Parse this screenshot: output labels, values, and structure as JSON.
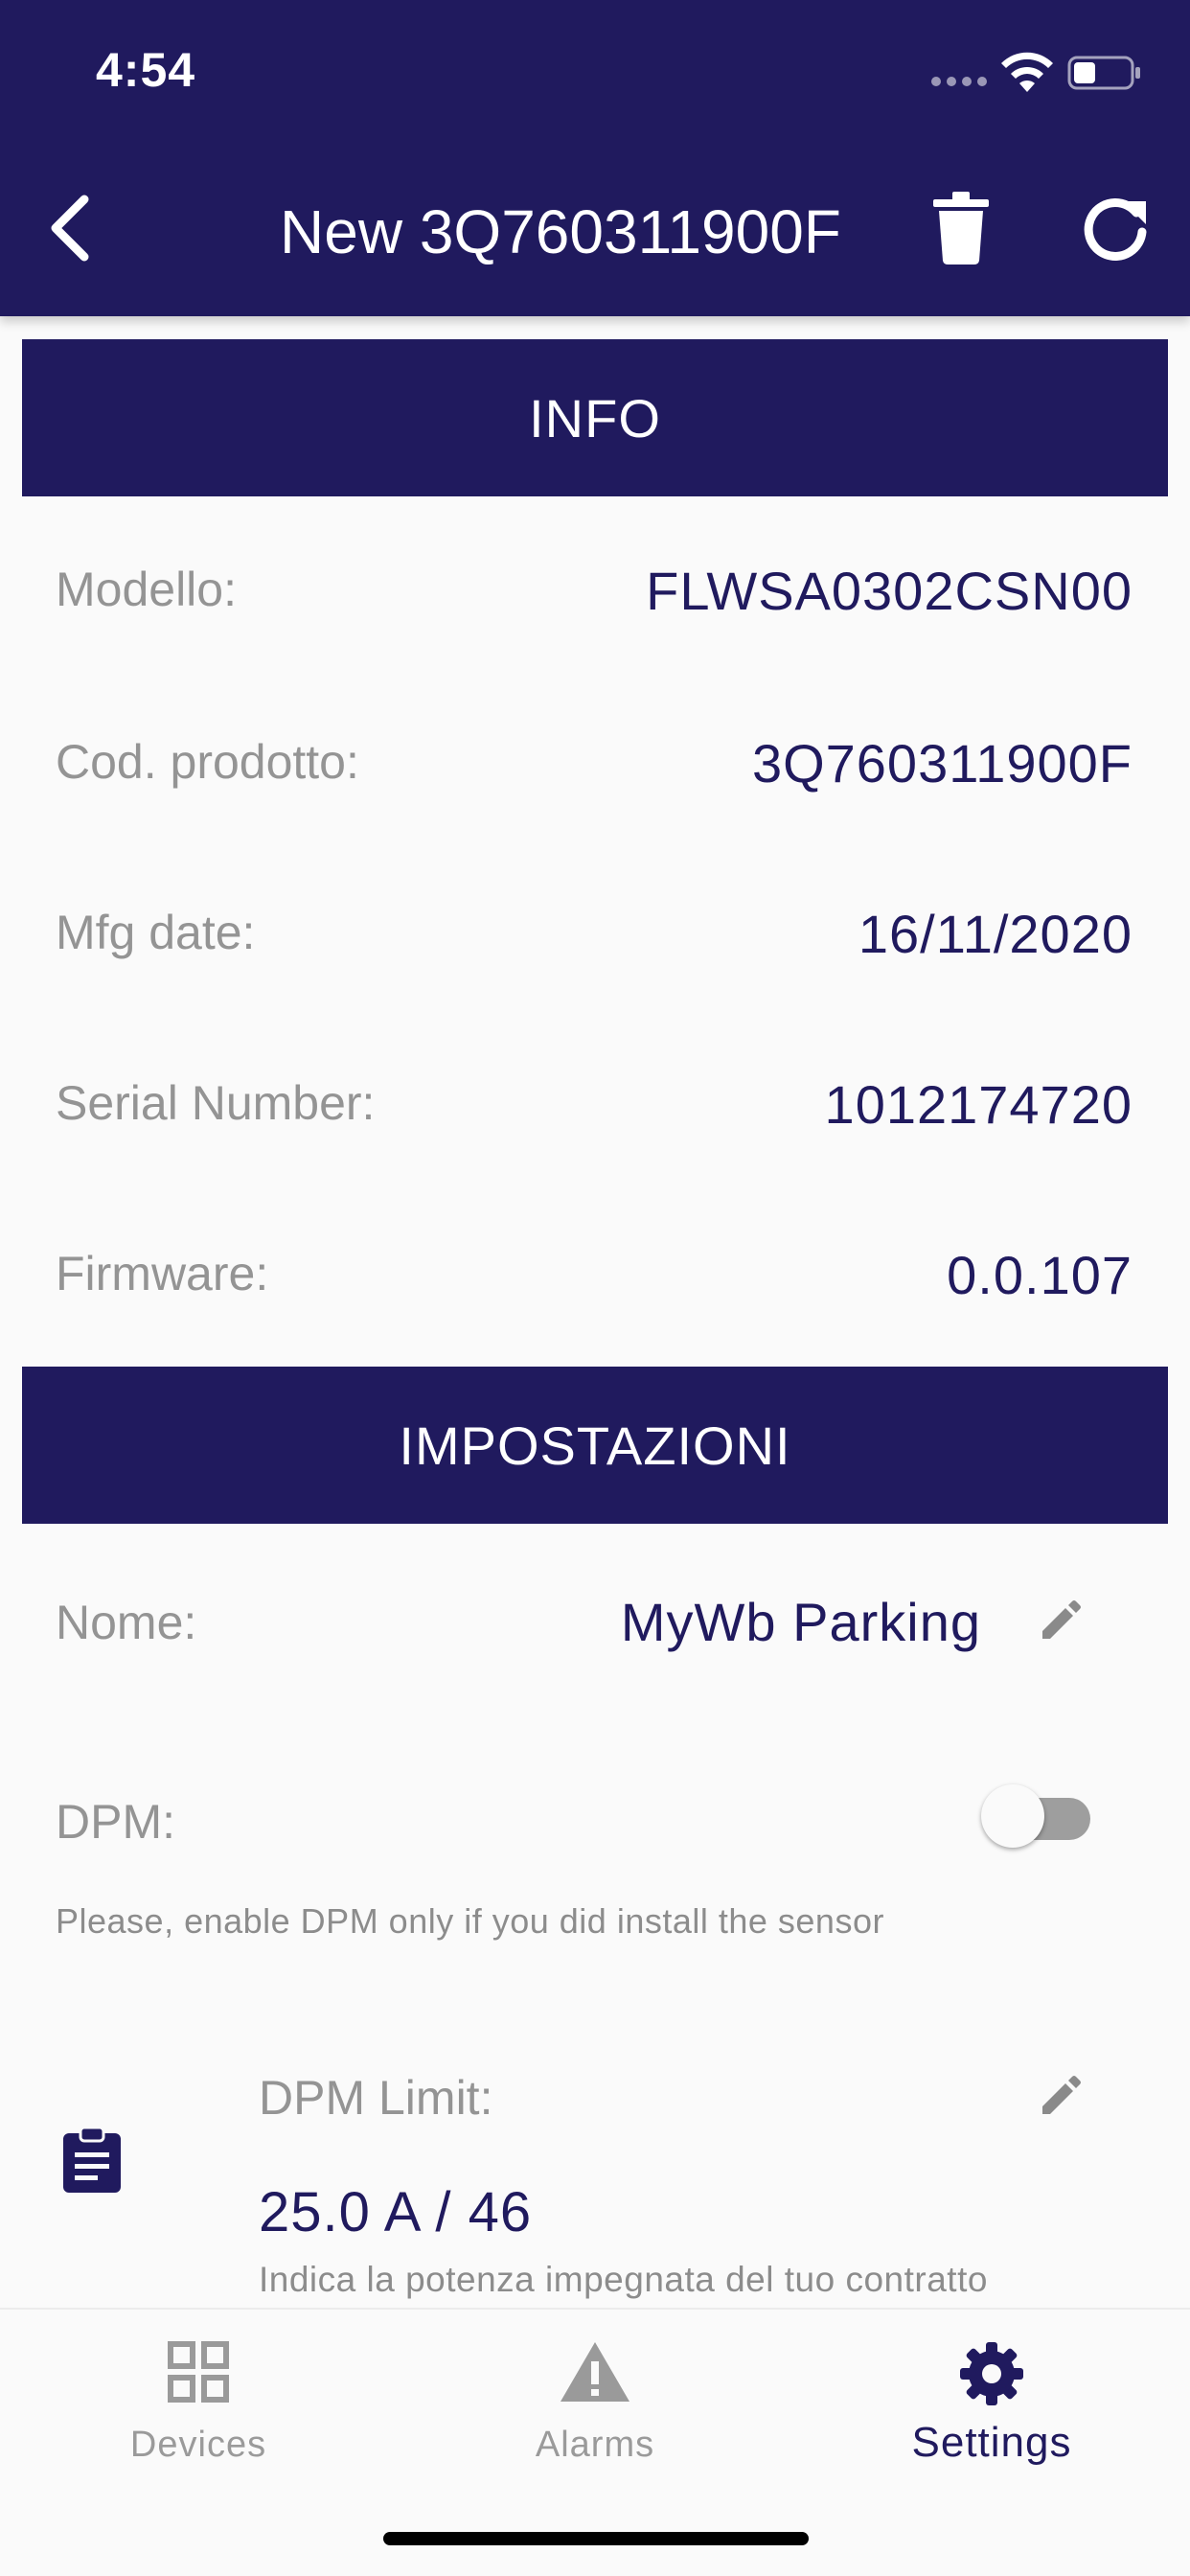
{
  "status_bar": {
    "time": "4:54"
  },
  "nav": {
    "title": "New 3Q760311900F",
    "icons": {
      "back": "chevron-left-icon",
      "delete": "trash-icon",
      "refresh": "refresh-icon"
    }
  },
  "info": {
    "header": "INFO",
    "rows": [
      {
        "label": "Modello:",
        "value": "FLWSA0302CSN00"
      },
      {
        "label": "Cod. prodotto:",
        "value": "3Q760311900F"
      },
      {
        "label": "Mfg date:",
        "value": "16/11/2020"
      },
      {
        "label": "Serial Number:",
        "value": "1012174720"
      },
      {
        "label": "Firmware:",
        "value": "0.0.107"
      }
    ]
  },
  "settings": {
    "header": "IMPOSTAZIONI",
    "name_label": "Nome:",
    "name_value": "MyWb Parking",
    "dpm_label": "DPM:",
    "dpm_enabled": false,
    "dpm_helper": "Please, enable DPM only if you did install the sensor",
    "dpm_limit_label": "DPM Limit:",
    "dpm_limit_value": "25.0 A / 46",
    "dpm_limit_desc": "Indica la potenza impegnata del tuo contratto"
  },
  "bottom_nav": {
    "items": [
      {
        "label": "Devices",
        "icon": "grid-icon",
        "active": false
      },
      {
        "label": "Alarms",
        "icon": "warning-icon",
        "active": false
      },
      {
        "label": "Settings",
        "icon": "gear-icon",
        "active": true
      }
    ]
  },
  "colors": {
    "primary": "#201a5e",
    "label_gray": "#949494",
    "background": "#fafafa"
  }
}
